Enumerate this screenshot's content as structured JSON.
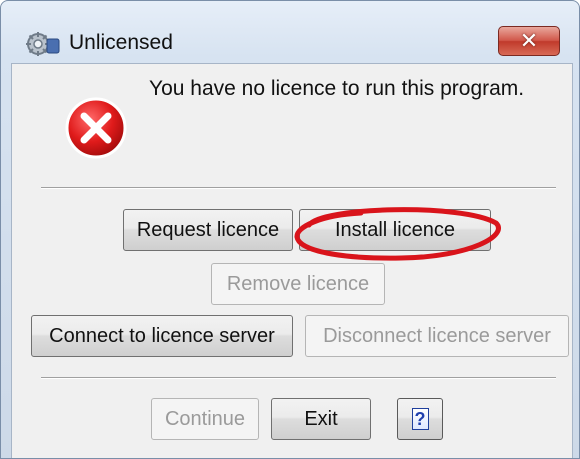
{
  "window": {
    "title": "Unlicensed",
    "title_icon": "gear-icon",
    "close_glyph": "✕"
  },
  "dialog": {
    "icon": "error-icon",
    "message": "You have no licence to run this program."
  },
  "buttons": {
    "request_licence": "Request licence",
    "install_licence": "Install licence",
    "remove_licence": "Remove licence",
    "connect_server": "Connect to licence server",
    "disconnect_server": "Disconnect licence server",
    "continue": "Continue",
    "exit": "Exit",
    "help": "?"
  },
  "annotation": {
    "shape": "hand-drawn-ellipse",
    "color": "#d9141b",
    "target": "install_licence"
  },
  "colors": {
    "error_red": "#d9141b",
    "close_red": "#c9473a",
    "help_blue": "#1f3fae"
  }
}
